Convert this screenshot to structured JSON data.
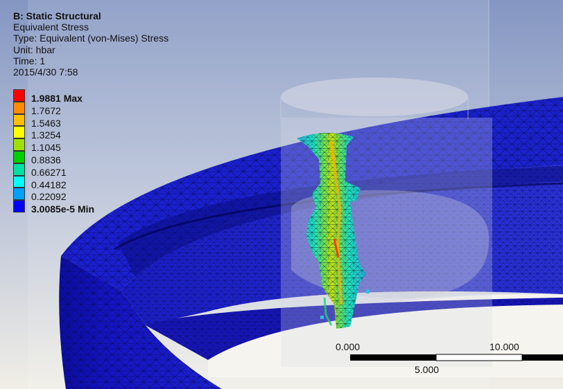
{
  "info": {
    "title": "B: Static Structural",
    "result_name": "Equivalent Stress",
    "type_line": "Type: Equivalent (von-Mises) Stress",
    "unit_line": "Unit: hbar",
    "time_line": "Time: 1",
    "timestamp": "2015/4/30 7:58"
  },
  "legend": {
    "entries": [
      {
        "label": "1.9881 Max",
        "color": "#ff0000",
        "bold": true
      },
      {
        "label": "1.7672",
        "color": "#ff8c00",
        "bold": false
      },
      {
        "label": "1.5463",
        "color": "#ffc000",
        "bold": false
      },
      {
        "label": "1.3254",
        "color": "#ffff00",
        "bold": false
      },
      {
        "label": "1.1045",
        "color": "#a0e000",
        "bold": false
      },
      {
        "label": "0.8836",
        "color": "#00d000",
        "bold": false
      },
      {
        "label": "0.66271",
        "color": "#00e0a0",
        "bold": false
      },
      {
        "label": "0.44182",
        "color": "#00ffff",
        "bold": false
      },
      {
        "label": "0.22092",
        "color": "#00a0ff",
        "bold": false
      },
      {
        "label": "3.0085e-5 Min",
        "color": "#0000ff",
        "bold": true
      }
    ]
  },
  "scale": {
    "labels": [
      "0.000",
      "5.000",
      "10.000"
    ]
  },
  "colors": {
    "background_top": "#8496c2",
    "background_bottom": "#f0eee6",
    "mesh_blue": "#1a14cc",
    "mesh_line": "#080840"
  }
}
